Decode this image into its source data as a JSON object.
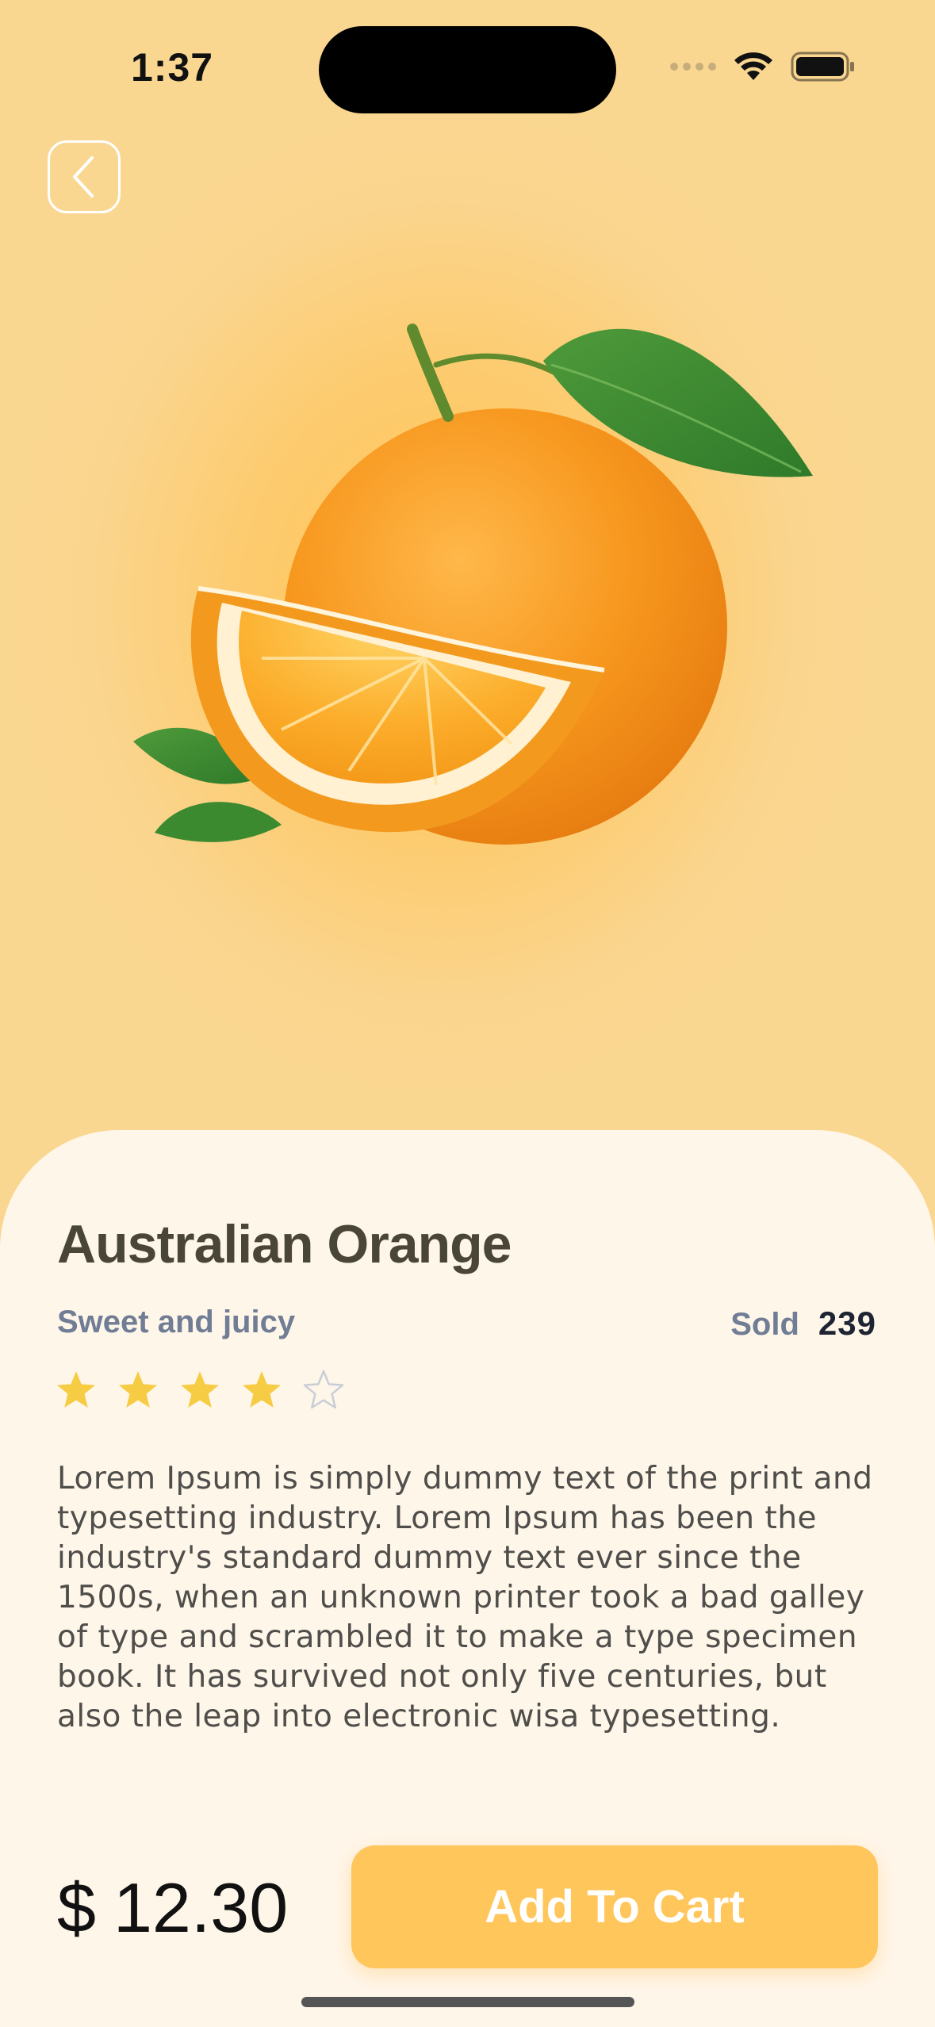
{
  "status_bar": {
    "time": "1:37"
  },
  "product": {
    "name": "Australian Orange",
    "tagline": "Sweet and juicy",
    "sold_label": "Sold",
    "sold_count": "239",
    "rating": 4,
    "rating_max": 5,
    "description": "Lorem Ipsum is simply dummy text of the print and typesetting industry. Lorem Ipsum has been the industry's standard dummy text ever since the 1500s, when an unknown printer took a bad galley of type and scrambled it to make a type specimen book. It has survived not only five centuries, but also the leap into electronic wisa typesetting.",
    "price_currency": "$",
    "price_value": "12.30"
  },
  "actions": {
    "add_to_cart_label": "Add To Cart"
  },
  "icons": {
    "back": "chevron-left-icon",
    "star_filled": "star-filled-icon",
    "star_empty": "star-outline-icon",
    "wifi": "wifi-icon",
    "battery": "battery-icon",
    "signal": "cellular-signal-icon"
  },
  "colors": {
    "background": "#FAD58E",
    "sheet": "#FFF6EA",
    "accent": "#FFC65B",
    "star": "#F7CC45",
    "title": "#4A4637",
    "muted": "#707D95"
  }
}
